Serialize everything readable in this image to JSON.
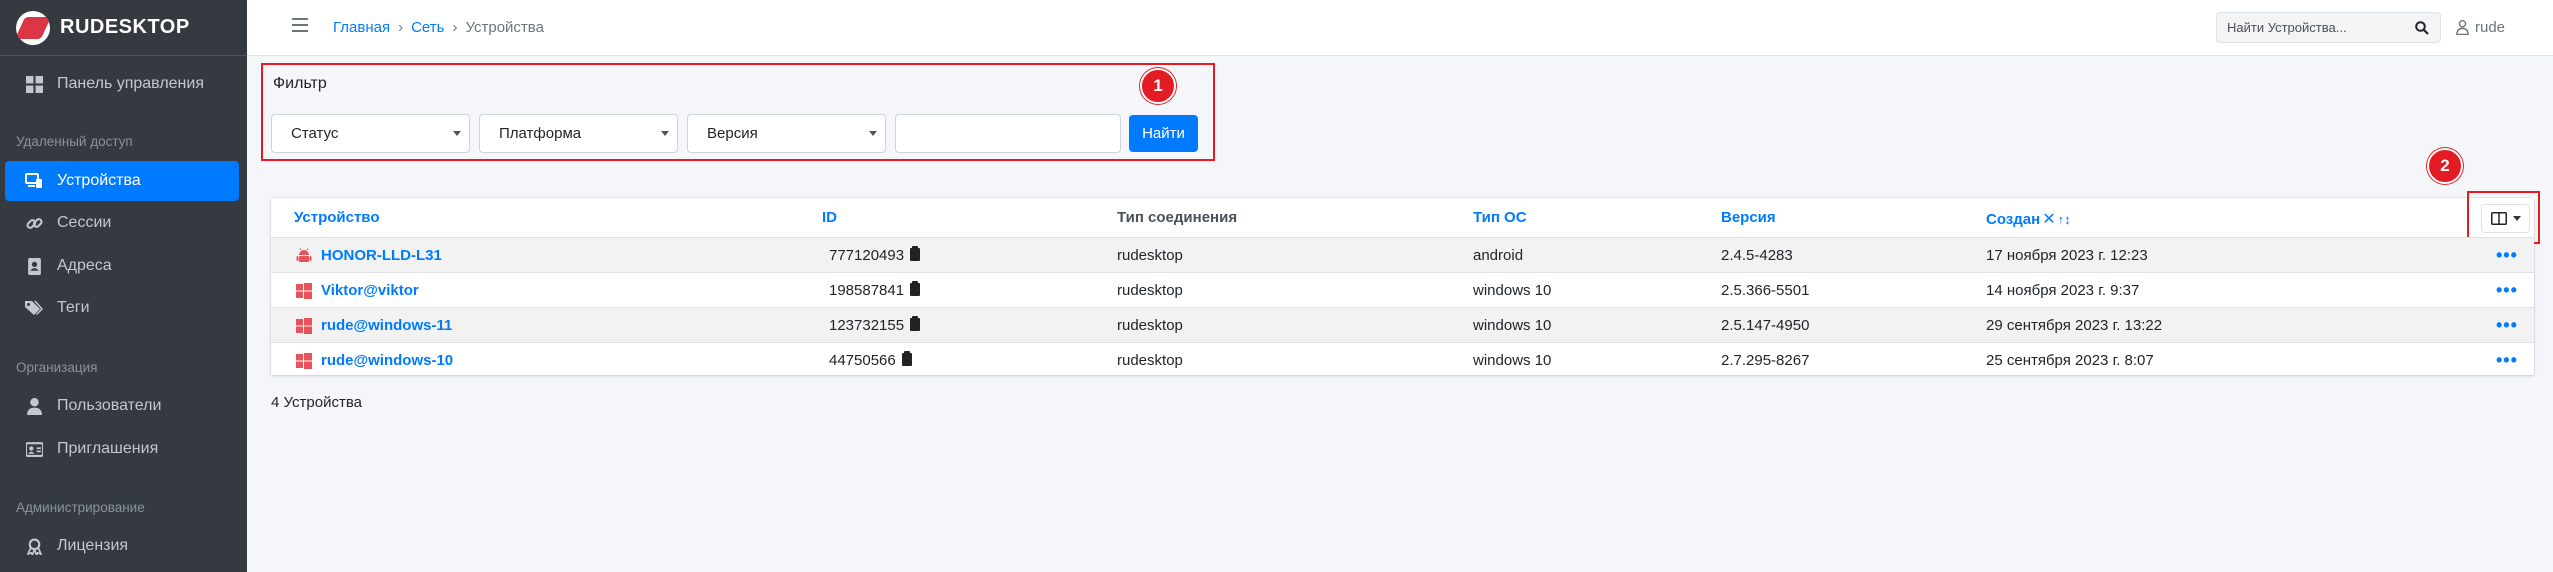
{
  "app": {
    "brand": "RUDESKTOP"
  },
  "sidebar": {
    "dashboard": "Панель управления",
    "section_remote": "Удаленный доступ",
    "devices": "Устройства",
    "sessions": "Сессии",
    "addresses": "Адреса",
    "tags": "Теги",
    "section_org": "Организация",
    "users": "Пользователи",
    "invites": "Приглашения",
    "section_admin": "Администрирование",
    "license": "Лицензия"
  },
  "header": {
    "breadcrumb": [
      "Главная",
      "Сеть",
      "Устройства"
    ],
    "search_placeholder": "Найти Устройства...",
    "user": "rude"
  },
  "filter": {
    "title": "Фильтр",
    "status": "Статус",
    "platform": "Платформа",
    "version": "Версия",
    "find_button": "Найти",
    "marker": "1"
  },
  "columns_marker": "2",
  "table": {
    "headers": {
      "device": "Устройство",
      "id": "ID",
      "connection": "Тип соединения",
      "os": "Тип ОС",
      "version": "Версия",
      "created": "Создан"
    },
    "rows": [
      {
        "device": "HONOR-LLD-L31",
        "icon": "android-icon",
        "id": "777120493",
        "connection": "rudesktop",
        "os": "android",
        "version": "2.4.5-4283",
        "created": "17 ноября 2023 г. 12:23"
      },
      {
        "device": "Viktor@viktor",
        "icon": "windows-icon",
        "id": "198587841",
        "connection": "rudesktop",
        "os": "windows 10",
        "version": "2.5.366-5501",
        "created": "14 ноября 2023 г. 9:37"
      },
      {
        "device": "rude@windows-11",
        "icon": "windows-icon",
        "id": "123732155",
        "connection": "rudesktop",
        "os": "windows 10",
        "version": "2.5.147-4950",
        "created": "29 сентября 2023 г. 13:22"
      },
      {
        "device": "rude@windows-10",
        "icon": "windows-icon",
        "id": "44750566",
        "connection": "rudesktop",
        "os": "windows 10",
        "version": "2.7.295-8267",
        "created": "25 сентября 2023 г. 8:07"
      }
    ],
    "count_label": "4 Устройства"
  },
  "colors": {
    "accent": "#007bff",
    "sidebar": "#343a40",
    "highlight": "#e8191f"
  }
}
